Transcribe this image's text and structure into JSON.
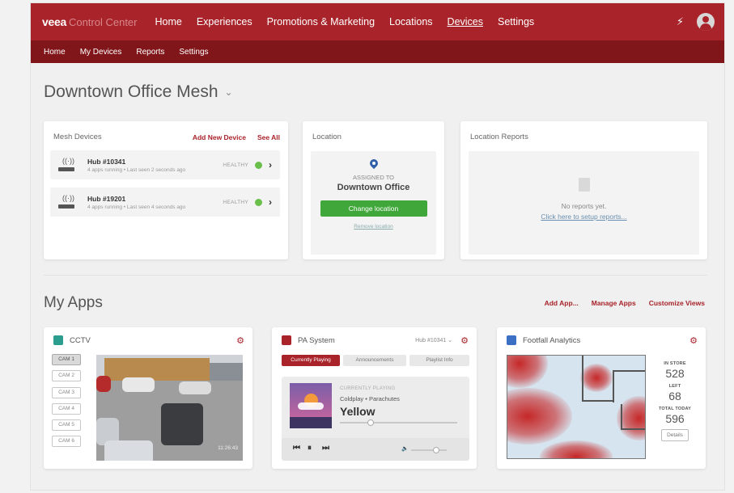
{
  "topbar": {
    "brand": "veea",
    "brand_sub": "Control Center",
    "nav": [
      "Home",
      "Experiences",
      "Promotions & Marketing",
      "Locations",
      "Devices",
      "Settings"
    ],
    "active_nav": "Devices",
    "accent_color": "#a8232a"
  },
  "subnav": [
    "Home",
    "My Devices",
    "Reports",
    "Settings"
  ],
  "page_title": "Downtown Office Mesh",
  "mesh": {
    "title": "Mesh Devices",
    "add_link": "Add New Device",
    "see_all": "See All",
    "devices": [
      {
        "name": "Hub #10341",
        "sub": "4 apps running • Last seen 2 seconds ago",
        "status": "HEALTHY"
      },
      {
        "name": "Hub #19201",
        "sub": "4 apps running • Last seen 4 seconds ago",
        "status": "HEALTHY"
      }
    ]
  },
  "location": {
    "title": "Location",
    "assigned": "ASSIGNED TO",
    "name": "Downtown Office",
    "change_btn": "Change location",
    "remove_link": "Remove location"
  },
  "reports": {
    "title": "Location Reports",
    "empty": "No reports yet.",
    "setup": "Click here to setup reports..."
  },
  "apps": {
    "title": "My Apps",
    "links": [
      "Add App...",
      "Manage Apps",
      "Customize Views"
    ]
  },
  "cctv": {
    "name": "CCTV",
    "cams": [
      "CAM 1",
      "CAM 2",
      "CAM 3",
      "CAM 4",
      "CAM 5",
      "CAM 6"
    ],
    "selected": "CAM 1",
    "timestamp": "11:26:43",
    "icon": "camera-icon",
    "icon_color": "#2a9d8f"
  },
  "pa": {
    "name": "PA System",
    "hub": "Hub #10341",
    "tabs": [
      "Currently Playing",
      "Announcements",
      "Playlist Info"
    ],
    "now_playing_label": "CURRENTLY PLAYING",
    "artist": "Coldplay • Parachutes",
    "song": "Yellow",
    "progress": 0.25,
    "volume": 0.75,
    "icon": "speaker-icon",
    "icon_color": "#a8232a"
  },
  "footfall": {
    "name": "Footfall Analytics",
    "in_store_label": "IN STORE",
    "in_store": "528",
    "left_label": "LEFT",
    "left": "68",
    "total_label": "TOTAL TODAY",
    "total": "596",
    "details_btn": "Details",
    "icon": "chart-icon",
    "icon_color": "#3a6fc4"
  }
}
